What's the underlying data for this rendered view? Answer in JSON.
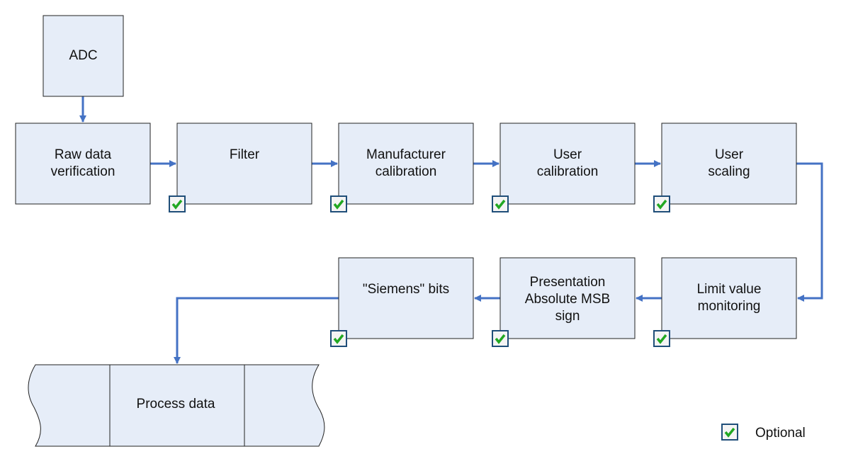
{
  "colors": {
    "box_fill": "#e6edf8",
    "box_stroke": "#222222",
    "arrow": "#4472c4",
    "check_border": "#1f4e79",
    "check_mark": "#22a822"
  },
  "nodes": [
    {
      "id": "adc",
      "lines": [
        "ADC"
      ],
      "optional": false
    },
    {
      "id": "raw",
      "lines": [
        "Raw data",
        "verification"
      ],
      "optional": false
    },
    {
      "id": "filter",
      "lines": [
        "Filter"
      ],
      "optional": true
    },
    {
      "id": "mfg",
      "lines": [
        "Manufacturer",
        "calibration"
      ],
      "optional": true
    },
    {
      "id": "ucal",
      "lines": [
        "User",
        "calibration"
      ],
      "optional": true
    },
    {
      "id": "uscale",
      "lines": [
        "User",
        "scaling"
      ],
      "optional": true
    },
    {
      "id": "limit",
      "lines": [
        "Limit value",
        "monitoring"
      ],
      "optional": true
    },
    {
      "id": "pres",
      "lines": [
        "Presentation",
        "Absolute MSB",
        "sign"
      ],
      "optional": true
    },
    {
      "id": "siemens",
      "lines": [
        "\"Siemens\" bits"
      ],
      "optional": true
    }
  ],
  "process_data": {
    "label": "Process data"
  },
  "legend": {
    "icon": "checkbox-check-icon",
    "label": "Optional"
  }
}
